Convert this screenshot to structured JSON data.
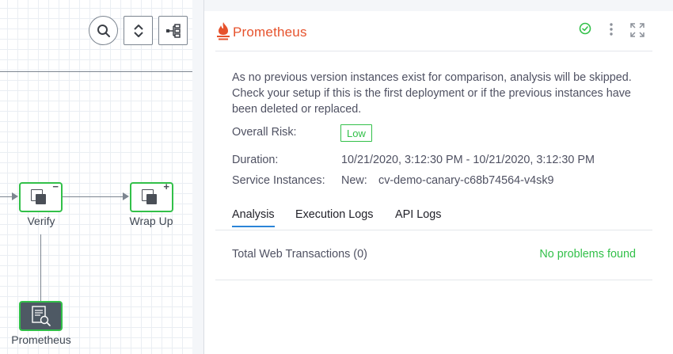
{
  "pipeline": {
    "toolbar": {
      "search_icon": "search-icon",
      "expand_collapse_icon": "chevron-up-down-icon",
      "layout_icon": "tree-layout-icon"
    },
    "nodes": [
      {
        "label": "Verify",
        "state_mark": "−",
        "status": "success"
      },
      {
        "label": "Wrap Up",
        "state_mark": "+",
        "status": "success"
      },
      {
        "label": "Prometheus",
        "status": "success",
        "icon": "document-search-icon"
      }
    ]
  },
  "panel": {
    "title": "Prometheus",
    "logo_icon": "prometheus-flame-icon",
    "actions": [
      "check-circle-icon",
      "more-vertical-icon",
      "expand-icon"
    ],
    "message": "As no previous version instances exist for comparison, analysis will be skipped. Check your setup if this is the first deployment or if the previous instances have been deleted or replaced.",
    "details": {
      "risk_label": "Overall Risk:",
      "risk_value": "Low",
      "duration_label": "Duration:",
      "duration_value": "10/21/2020, 3:12:30 PM - 10/21/2020, 3:12:30 PM",
      "instances_label": "Service Instances:",
      "instances_prefix": "New:",
      "instances_value": "cv-demo-canary-c68b74564-v4sk9"
    },
    "tabs": [
      {
        "label": "Analysis",
        "active": true
      },
      {
        "label": "Execution Logs",
        "active": false
      },
      {
        "label": "API Logs",
        "active": false
      }
    ],
    "analysis_row": {
      "title": "Total Web Transactions (0)",
      "status": "No problems found"
    }
  },
  "colors": {
    "success": "#32c049",
    "brand": "#e6522c",
    "tab_active": "#2b84d8",
    "node_dark": "#4e5964"
  }
}
